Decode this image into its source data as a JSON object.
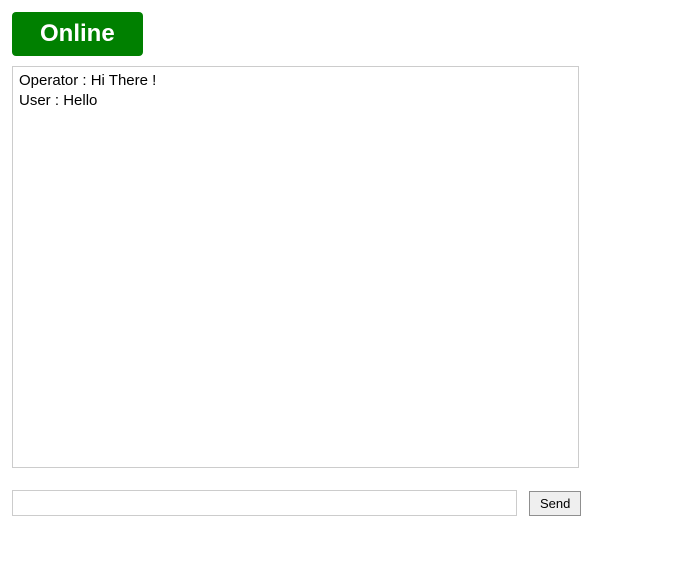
{
  "status": {
    "label": "Online",
    "bg_color": "#008000"
  },
  "chat": {
    "messages": [
      {
        "sender": "Operator",
        "text": "Hi There !"
      },
      {
        "sender": "User",
        "text": "Hello"
      }
    ]
  },
  "input": {
    "value": "",
    "placeholder": ""
  },
  "buttons": {
    "send": "Send"
  }
}
